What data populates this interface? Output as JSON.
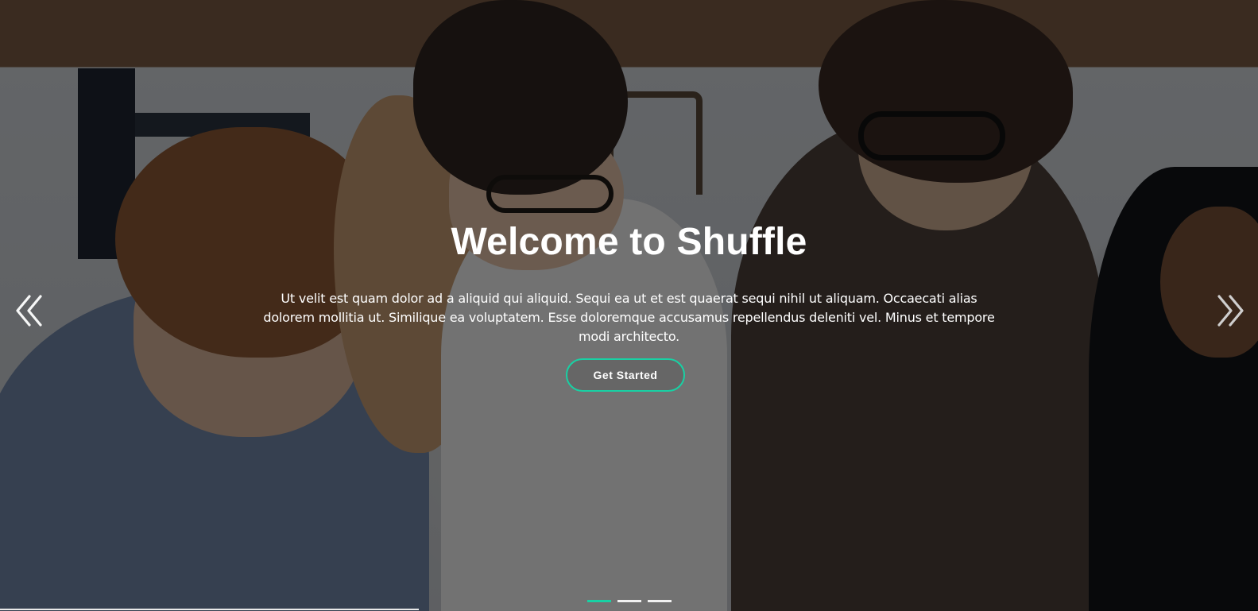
{
  "hero": {
    "title": "Welcome to Shuffle",
    "description": "Ut velit est quam dolor ad a aliquid qui aliquid. Sequi ea ut et est quaerat sequi nihil ut aliquam. Occaecati alias dolorem mollitia ut. Similique ea voluptatem. Esse doloremque accusamus repellendus deleniti vel. Minus et tempore modi architecto.",
    "cta_label": "Get Started"
  },
  "controls": {
    "left_icon": "double-chevron-left-icon",
    "right_icon": "double-chevron-right-icon"
  },
  "carousel": {
    "slides": 3,
    "active_index": 0
  },
  "colors": {
    "accent": "#18d1a4",
    "text": "#ffffff",
    "overlay": "#000000"
  }
}
